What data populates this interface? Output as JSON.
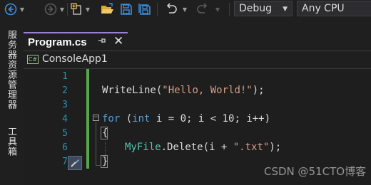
{
  "toolbar": {
    "configuration": "Debug",
    "platform": "Any CPU"
  },
  "side_panel": {
    "tabs": [
      "服务器资源管理器",
      "工具箱"
    ]
  },
  "document_tab": {
    "title": "Program.cs",
    "pin": "ᛘ",
    "close": "✕"
  },
  "nav": {
    "project_icon_text": "C#",
    "project": "ConsoleApp1"
  },
  "editor": {
    "line_numbers": [
      "1",
      "2",
      "3",
      "4",
      "5",
      "6",
      "7"
    ],
    "lines": {
      "l2": {
        "method": "WriteLine(",
        "string": "\"Hello, World!\"",
        "tail": ");"
      },
      "l4": {
        "kw_for": "for",
        "p1": " (",
        "kw_int": "int",
        "p2": " i = 0; i < 10; i++)"
      },
      "l5": {
        "brace": "{"
      },
      "l6": {
        "type": "MyFile",
        "call": ".Delete(i + ",
        "string": "\".txt\"",
        "tail": ");"
      },
      "l7": {
        "brace": "}"
      }
    }
  },
  "watermark": "CSDN @51CTO博客"
}
